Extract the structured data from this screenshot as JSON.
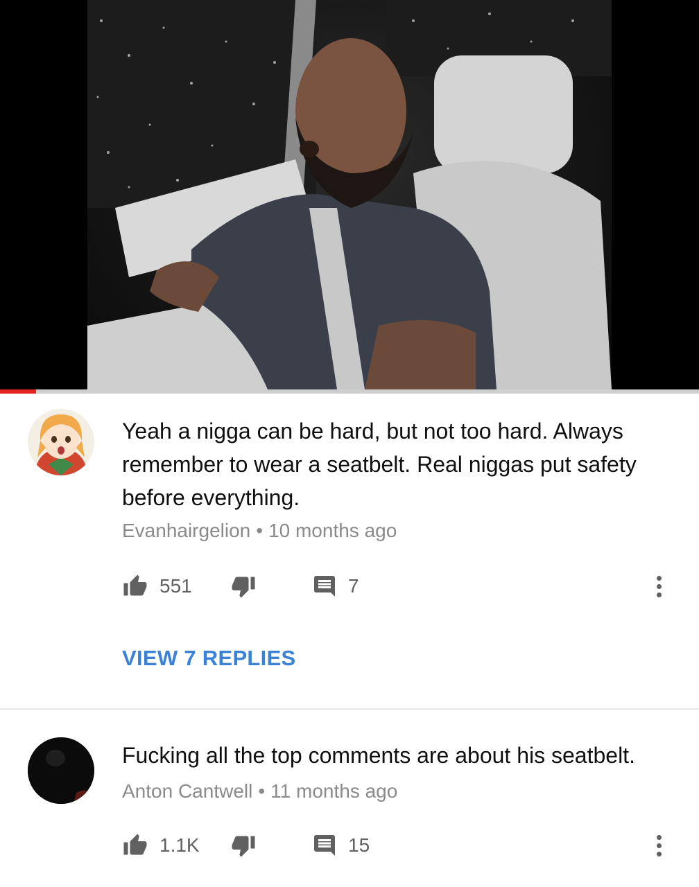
{
  "video": {
    "progress": 0.052,
    "accent_color": "#e52521"
  },
  "comments": [
    {
      "text": "Yeah a nigga can be hard, but not too hard. Always remember to wear a seatbelt. Real niggas put safety before everything.",
      "author": "Evanhairgelion",
      "separator": "•",
      "time": "10 months ago",
      "likes": "551",
      "replies_count": "7",
      "view_replies": "VIEW 7 REPLIES",
      "avatar_icon": "anime-girl-avatar"
    },
    {
      "text": "Fucking all the top comments are about his seatbelt.",
      "author": "Anton Cantwell",
      "separator": "•",
      "time": "11 months ago",
      "likes": "1.1K",
      "replies_count": "15",
      "avatar_icon": "dark-avatar"
    }
  ],
  "icons": {
    "like": "thumb-up-icon",
    "dislike": "thumb-down-icon",
    "reply": "comment-icon",
    "more": "more-vert-icon"
  },
  "colors": {
    "link": "#3b82d6",
    "meta_text": "#8a8a8a",
    "icon": "#606060"
  }
}
